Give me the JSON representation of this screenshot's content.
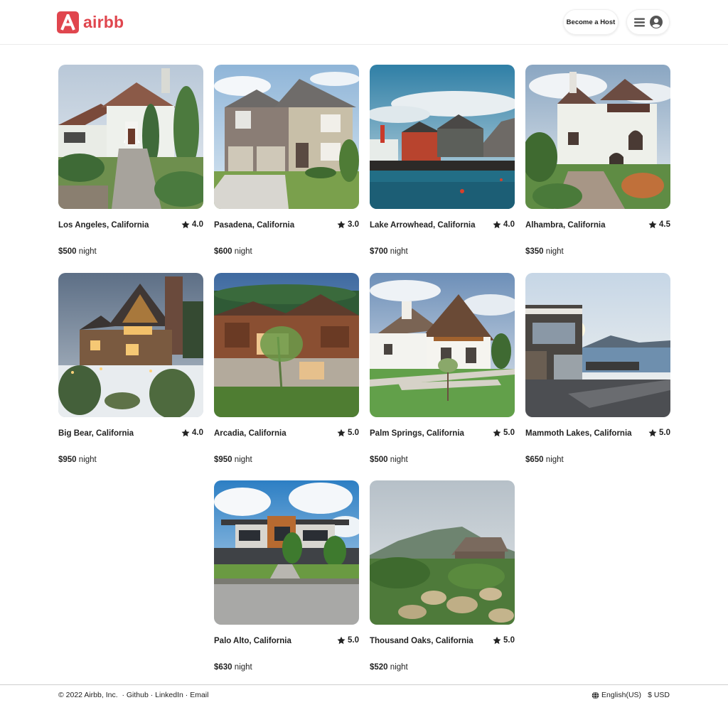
{
  "header": {
    "logo_text": "airbb",
    "become_host_label": "Become a Host",
    "brand_color": "#e0464e"
  },
  "listings": [
    {
      "location": "Los Angeles, California",
      "rating": "4.0",
      "price": "$500",
      "unit": "night",
      "photo": "tudor-style-house"
    },
    {
      "location": "Pasadena, California",
      "rating": "3.0",
      "price": "$600",
      "unit": "night",
      "photo": "brick-suburban-house"
    },
    {
      "location": "Lake Arrowhead, California",
      "rating": "4.0",
      "price": "$700",
      "unit": "night",
      "photo": "harbor-boathouses"
    },
    {
      "location": "Alhambra, California",
      "rating": "4.5",
      "price": "$350",
      "unit": "night",
      "photo": "white-villa"
    },
    {
      "location": "Big Bear, California",
      "rating": "4.0",
      "price": "$950",
      "unit": "night",
      "photo": "snowy-chalet"
    },
    {
      "location": "Arcadia, California",
      "rating": "5.0",
      "price": "$950",
      "unit": "night",
      "photo": "timber-lodge"
    },
    {
      "location": "Palm Springs, California",
      "rating": "5.0",
      "price": "$500",
      "unit": "night",
      "photo": "white-chalet-lawn"
    },
    {
      "location": "Mammoth Lakes, California",
      "rating": "5.0",
      "price": "$650",
      "unit": "night",
      "photo": "lakeside-modern-house"
    },
    {
      "location": "Palo Alto, California",
      "rating": "5.0",
      "price": "$630",
      "unit": "night",
      "photo": "modern-wood-house"
    },
    {
      "location": "Thousand Oaks, California",
      "rating": "5.0",
      "price": "$520",
      "unit": "night",
      "photo": "mountain-cabin"
    }
  ],
  "footer": {
    "copyright": "© 2022 Airbb, Inc.",
    "links": [
      "Github",
      "LinkedIn",
      "Email"
    ],
    "language": "English(US)",
    "currency": "$ USD"
  }
}
